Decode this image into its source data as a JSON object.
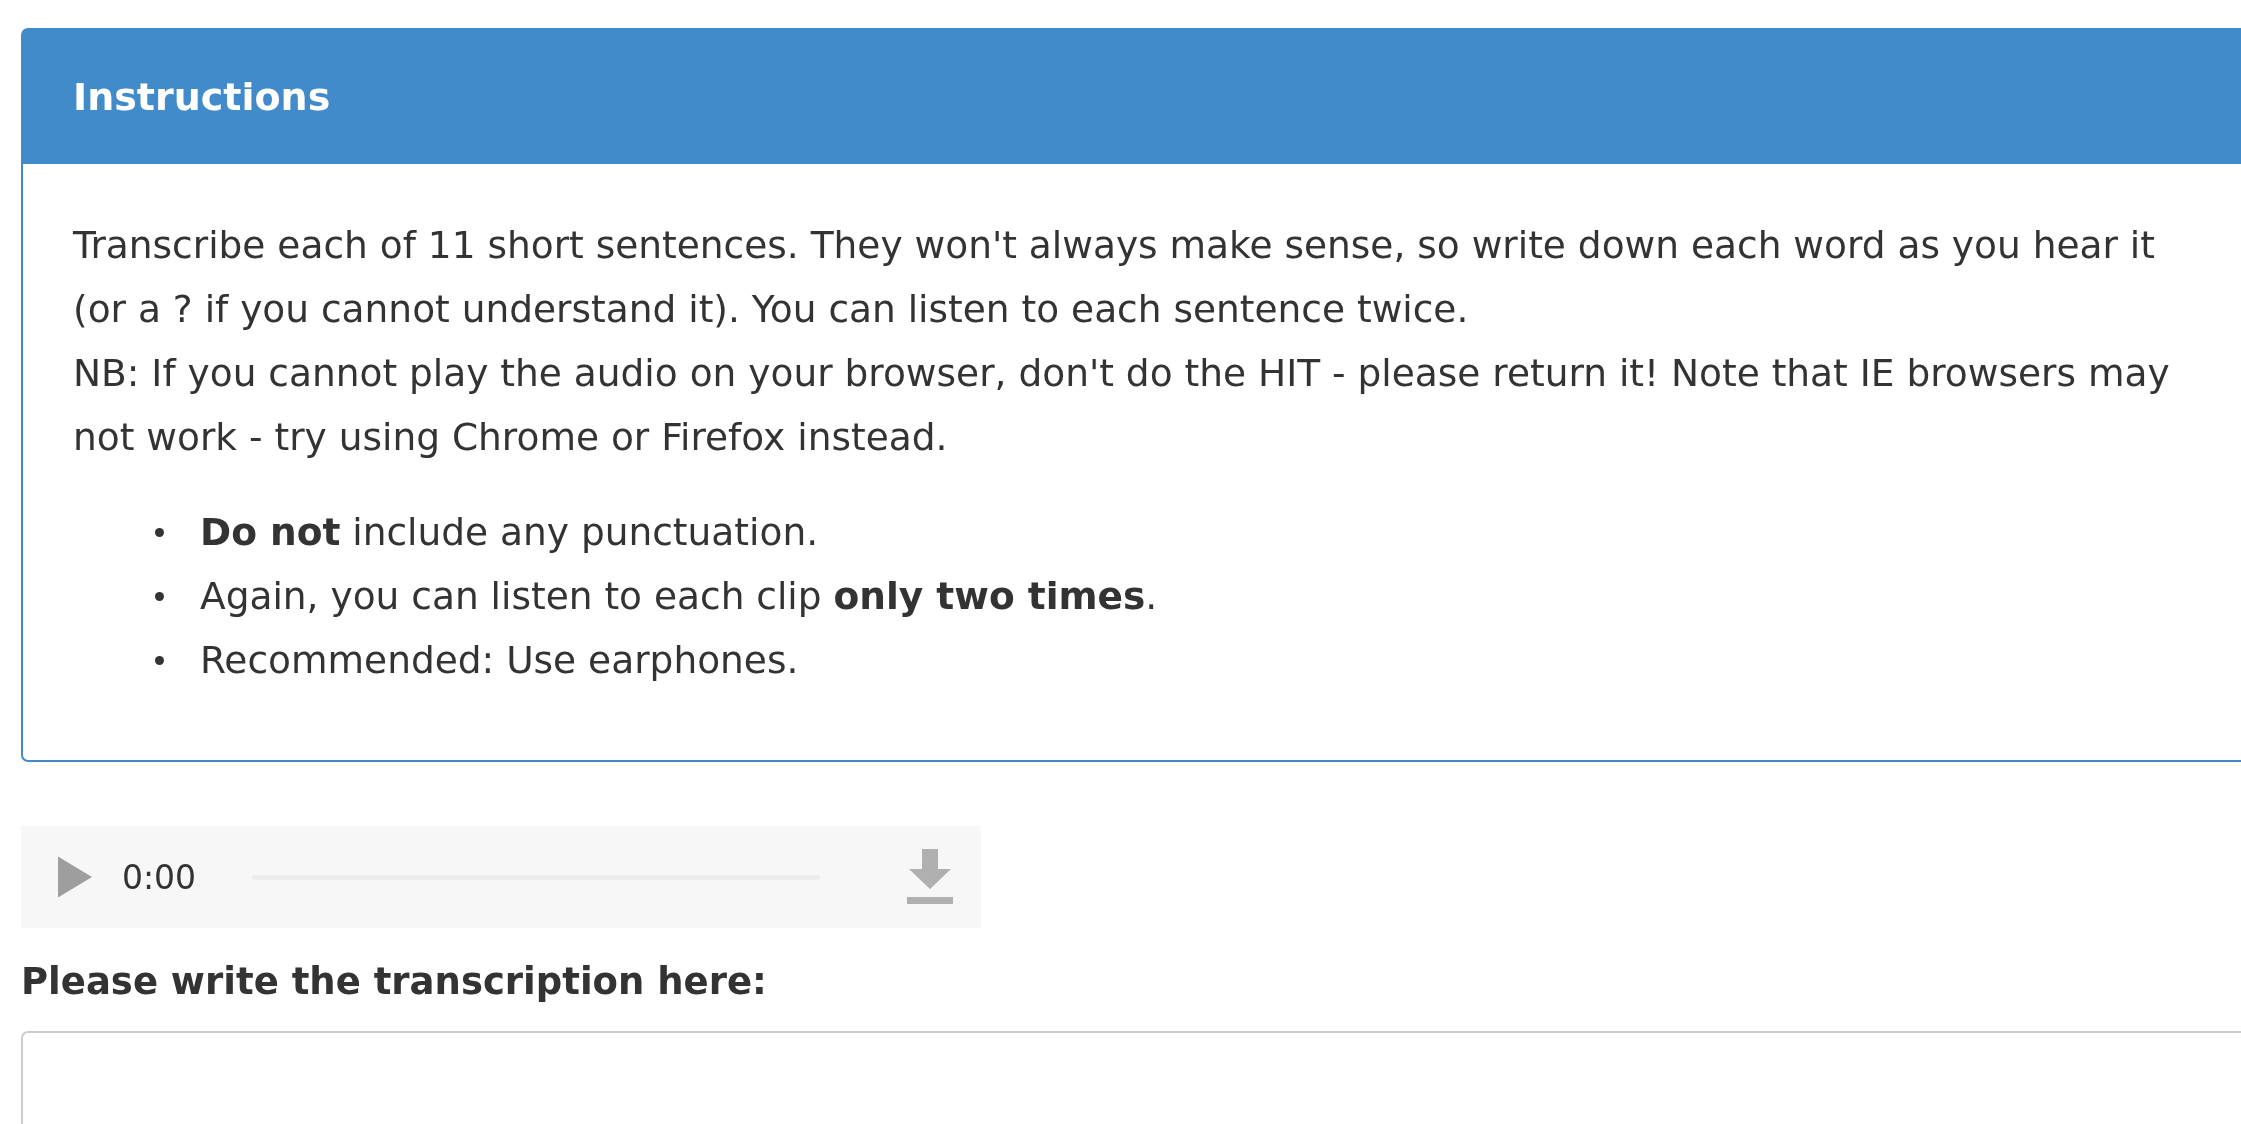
{
  "panel": {
    "title": "Instructions",
    "paragraphs": [
      "Transcribe each of 11 short sentences. They won't always make sense, so write down each word as you hear it (or a ? if you cannot understand it). You can listen to each sentence twice.",
      "NB: If you cannot play the audio on your browser, don't do the HIT - please return it! Note that IE browsers may not work - try using Chrome or Firefox instead."
    ],
    "bullets": [
      "**Do not** include any punctuation.",
      "Again, you can listen to each clip **only two times**.",
      "Recommended: Use earphones."
    ]
  },
  "audio_player": {
    "time": "0:00"
  },
  "transcription": {
    "label": "Please write the transcription here:"
  }
}
